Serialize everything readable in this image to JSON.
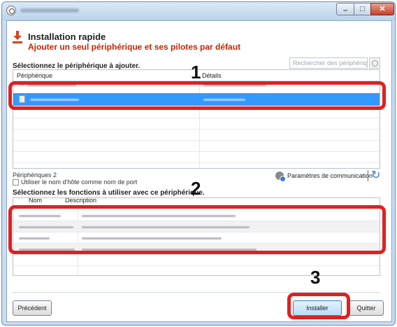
{
  "header": {
    "title": "Installation rapide",
    "subtitle": "Ajouter un seul périphérique et ses pilotes par défaut"
  },
  "device_section": {
    "label": "Sélectionnez le périphérique à ajouter.",
    "search_placeholder": "Rechercher des périphériques",
    "columns": [
      "Périphérique",
      "Détails"
    ],
    "count_text": "Périphériques 2"
  },
  "options": {
    "hostname_checkbox_label": "Utiliser le nom d'hôte comme nom de port",
    "comm_settings_label": "Paramètres de communication"
  },
  "function_section": {
    "label": "Sélectionnez les fonctions à utiliser avec ce périphérique.",
    "columns": [
      "Nom",
      "Description"
    ]
  },
  "buttons": {
    "previous": "Précédent",
    "install": "Installer",
    "quit": "Quitter"
  },
  "annotations": [
    "1",
    "2",
    "3"
  ],
  "colors": {
    "accent_red": "#e02020",
    "subtitle_red": "#cc2200",
    "selection_blue": "#3399ff",
    "refresh_blue": "#2e7bd1"
  },
  "icons": {
    "header": "download-arrow-icon",
    "search": "search-icon",
    "device": "printer-icon",
    "comm": "network-settings-icon",
    "refresh": "refresh-icon"
  }
}
